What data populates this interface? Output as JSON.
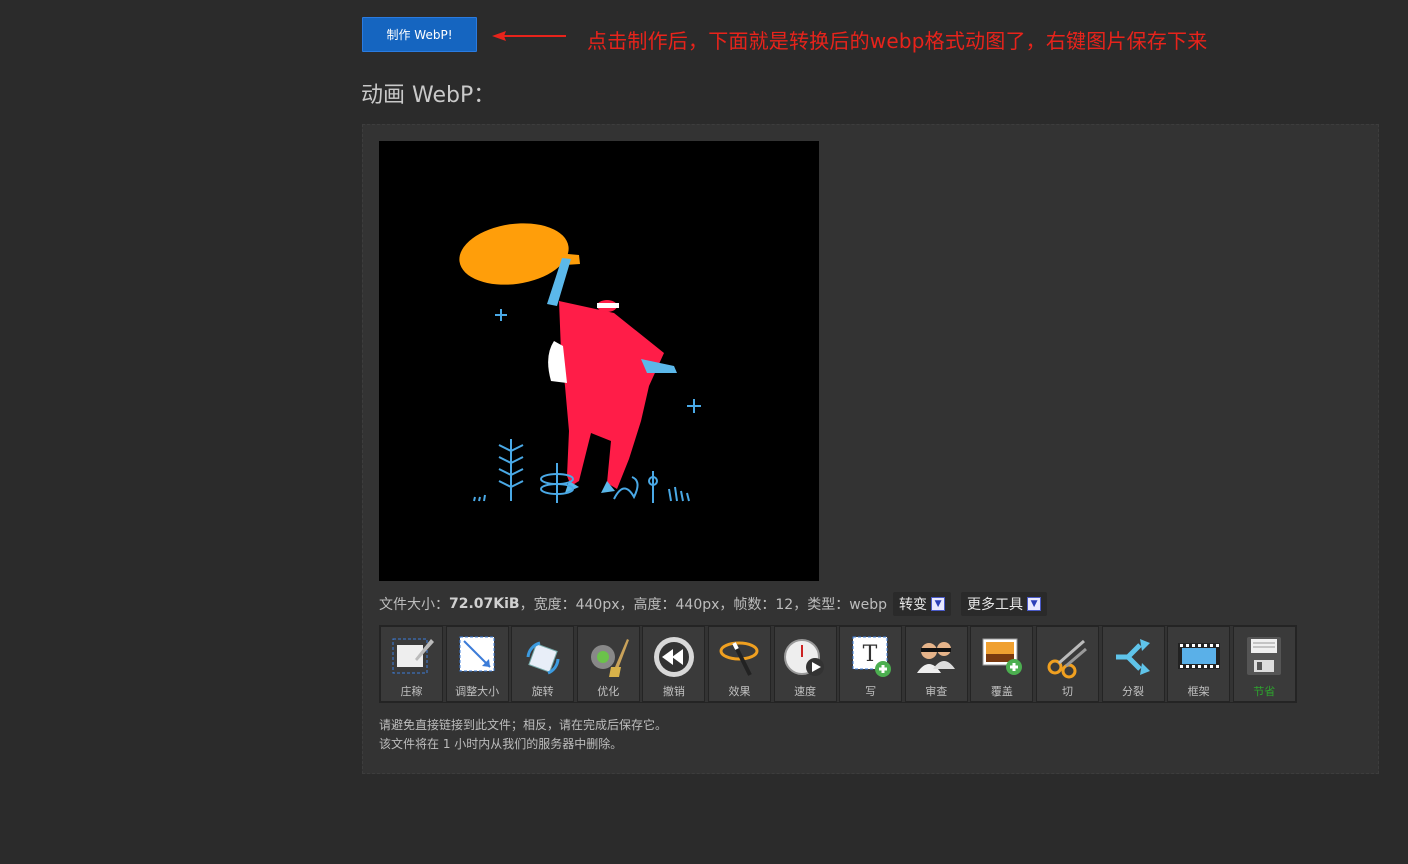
{
  "make_button": {
    "label": "制作 WebP!"
  },
  "annotation": {
    "text": "点击制作后，下面就是转换后的webp格式动图了，右键图片保存下来",
    "color": "#e8231b"
  },
  "section_title": "动画 WebP：",
  "file_info": {
    "size_label": "文件大小：",
    "size_value": "72.07KiB",
    "rest": "，宽度：440px，高度：440px，帧数：12，类型：webp",
    "convert_label": "转变",
    "more_tools_label": "更多工具"
  },
  "tools": [
    {
      "label": "庄稼",
      "icon": "crop-icon"
    },
    {
      "label": "调整大小",
      "icon": "resize-icon"
    },
    {
      "label": "旋转",
      "icon": "rotate-icon"
    },
    {
      "label": "优化",
      "icon": "optimize-icon"
    },
    {
      "label": "撤销",
      "icon": "reverse-icon"
    },
    {
      "label": "效果",
      "icon": "effects-icon"
    },
    {
      "label": "速度",
      "icon": "speed-icon"
    },
    {
      "label": "写",
      "icon": "write-text-icon"
    },
    {
      "label": "审查",
      "icon": "censor-icon"
    },
    {
      "label": "覆盖",
      "icon": "overlay-icon"
    },
    {
      "label": "切",
      "icon": "cut-icon"
    },
    {
      "label": "分裂",
      "icon": "split-icon"
    },
    {
      "label": "框架",
      "icon": "frames-icon"
    },
    {
      "label": "节省",
      "icon": "save-icon"
    }
  ],
  "notice": {
    "line1": "请避免直接链接到此文件；相反，请在完成后保存它。",
    "line2": "该文件将在 1 小时内从我们的服务器中删除。"
  },
  "colors": {
    "accent": "#1565c0",
    "background": "#2b2b2b",
    "panel": "#333333"
  }
}
